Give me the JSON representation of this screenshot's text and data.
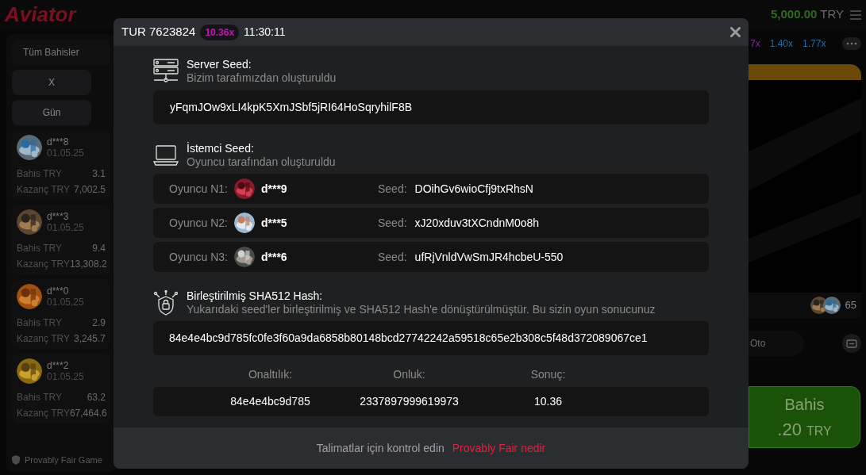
{
  "app": {
    "logo": "Aviator",
    "balance": "5,000.00",
    "currency": "TRY"
  },
  "bets_panel": {
    "tab": "Tüm Bahisler",
    "filters": [
      "X",
      "Gün"
    ],
    "bets": [
      {
        "user": "d***8",
        "date": "01.05.25",
        "bet_label": "Bahis TRY",
        "bet": "3.1",
        "win_label": "Kazanç TRY",
        "win": "7,002.5"
      },
      {
        "user": "d***3",
        "date": "01.05.25",
        "bet_label": "Bahis TRY",
        "bet": "9.4",
        "win_label": "Kazanç TRY",
        "win": "13,308.2"
      },
      {
        "user": "d***0",
        "date": "01.05.25",
        "bet_label": "Bahis TRY",
        "bet": "2.9",
        "win_label": "Kazanç TRY",
        "win": "3,245.7"
      },
      {
        "user": "d***2",
        "date": "01.05.25",
        "bet_label": "Bahis TRY",
        "bet": "63.2",
        "win_label": "Kazanç TRY",
        "win": "67,464.6"
      }
    ],
    "footer": "Provably Fair Game"
  },
  "multipliers": [
    {
      "value": "7x",
      "color": "#7b2a9c"
    },
    {
      "value": "1.40x",
      "color": "#2b6a9c"
    },
    {
      "value": "1.77x",
      "color": "#2b6a9c"
    }
  ],
  "game": {
    "players_count": "65",
    "mode": "Oto",
    "bet_button": {
      "label": "Bahis",
      "amount": ".20",
      "currency": "TRY"
    }
  },
  "modal": {
    "round": "TUR 7623824",
    "multiplier": "10.36x",
    "time": "11:30:11",
    "server_seed": {
      "title": "Server Seed:",
      "subtitle": "Bizim tarafımızdan oluşturuldu",
      "value": "yFqmJOw9xLI4kpK5XmJSbf5jRI64HoSqryhilF8B"
    },
    "client_seed": {
      "title": "İstemci Seed:",
      "subtitle": "Oyuncu tarafından oluşturuldu",
      "players": [
        {
          "label": "Oyuncu N1:",
          "name": "d***9",
          "seed_label": "Seed:",
          "seed": "DOihGv6wioCfj9txRhsN"
        },
        {
          "label": "Oyuncu N2:",
          "name": "d***5",
          "seed_label": "Seed:",
          "seed": "xJ20xduv3tXCndnM0o8h"
        },
        {
          "label": "Oyuncu N3:",
          "name": "d***6",
          "seed_label": "Seed:",
          "seed": "ufRjVnldVwSmJR4hcbeU-550"
        }
      ]
    },
    "hash": {
      "title": "Birleştirilmiş SHA512 Hash:",
      "subtitle": "Yukarıdaki seed'ler birleştirilmiş ve SHA512 Hash'e dönüştürülmüştür. Bu sizin oyun sonucunuz",
      "value": "84e4e4bc9d785fc0fe3f60a9da6858b80148bcd27742242a59518c65e2b308c5f48d372089067ce1"
    },
    "result": [
      {
        "label": "Onaltılık:",
        "value": "84e4e4bc9d785"
      },
      {
        "label": "Onluk:",
        "value": "2337897999619973"
      },
      {
        "label": "Sonuç:",
        "value": "10.36"
      }
    ],
    "footer": {
      "text": "Talimatlar için kontrol edin",
      "link": "Provably Fair nedir"
    }
  }
}
